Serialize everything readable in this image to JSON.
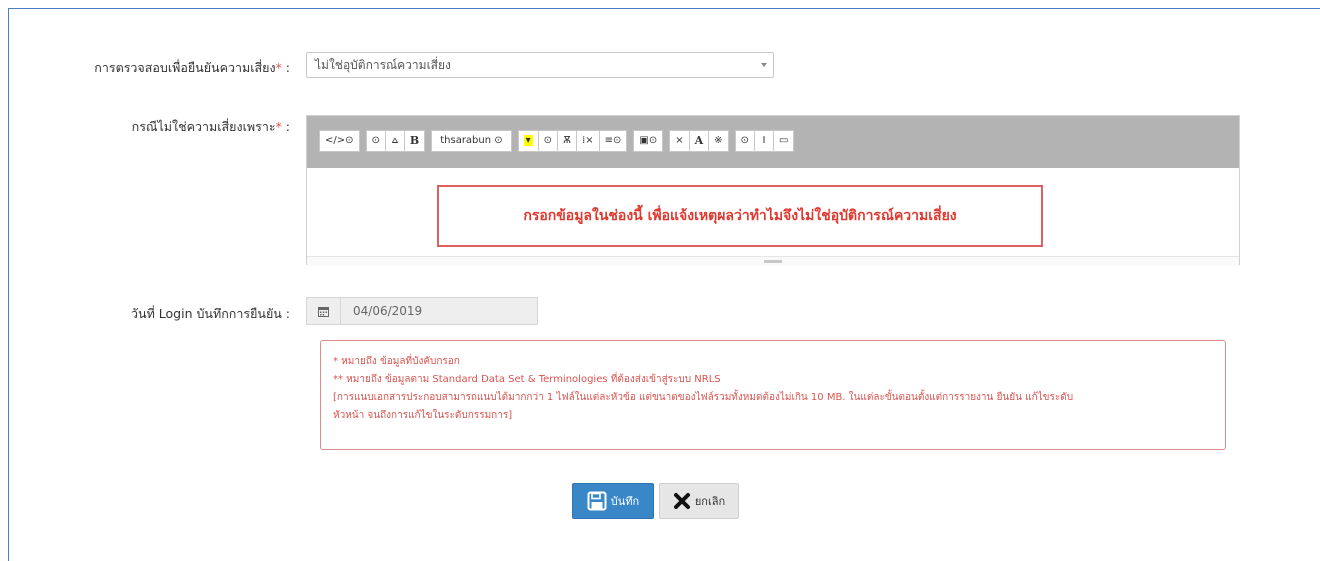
{
  "form": {
    "risk_check": {
      "label": "การตรวจสอบเพื่อยืนยันความเสี่ยง",
      "required_mark": "*",
      "suffix": " :",
      "selected": "ไม่ใช่อุบัติการณ์ความเสี่ยง"
    },
    "reason": {
      "label": "กรณีไม่ใช่ความเสี่ยงเพราะ",
      "required_mark": "*",
      "suffix": " :",
      "hint": "กรอกข้อมูลในช่องนี้ เพื่อแจ้งเหตุผลว่าทำไมจึงไม่ใช่อุบัติการณ์ความเสี่ยง"
    },
    "login_date": {
      "label": "วันที่ Login บันทึกการยืนยัน :",
      "value": "04/06/2019",
      "icon": "calendar-icon"
    }
  },
  "toolbar": {
    "code_view": "</>⊙",
    "style": "⊙",
    "superscript": "⩟",
    "bold": "B",
    "font_name": "thsarabun ⊙",
    "color": "▾",
    "color_dropdown": "⊙",
    "strikethrough": "Ѫ",
    "clear_format": "⁞×",
    "align": "≡⊙",
    "picture": "▣⊙",
    "remove": "×",
    "font_size": "A",
    "special": "※",
    "help": "⊙",
    "line_height": "I",
    "fullscreen": "▭"
  },
  "note": {
    "line1": "* หมายถึง ข้อมูลที่บังคับกรอก",
    "line2": "** หมายถึง ข้อมูลตาม Standard Data Set & Terminologies ที่ต้องส่งเข้าสู่ระบบ NRLS",
    "line3": "[การแนบเอกสารประกอบสามารถแนบได้มากกว่า 1 ไฟล์ในแต่ละหัวข้อ แต่ขนาดของไฟล์รวมทั้งหมดต้องไม่เกิน 10 MB. ในแต่ละขั้นตอนตั้งแต่การรายงาน ยืนยัน แก้ไขระดับ",
    "line4": "หัวหน้า จนถึงการแก้ไขในระดับกรรมการ]"
  },
  "buttons": {
    "save": "บันทึก",
    "cancel": "ยกเลิก"
  },
  "colors": {
    "primary": "#3a87c8",
    "danger": "#d9534f",
    "toolbar_bg": "#b3b3b3"
  }
}
